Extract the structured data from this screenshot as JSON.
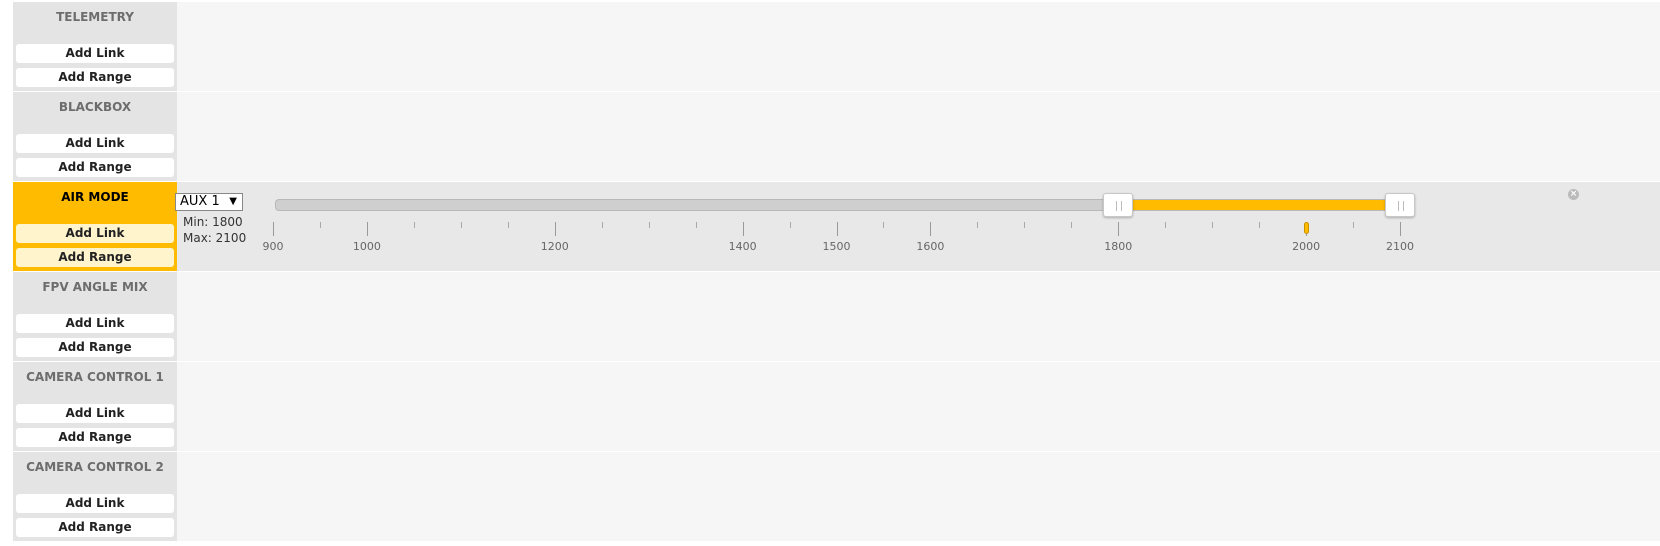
{
  "modes": [
    {
      "name": "TELEMETRY",
      "add_link": "Add Link",
      "add_range": "Add Range"
    },
    {
      "name": "BLACKBOX",
      "add_link": "Add Link",
      "add_range": "Add Range"
    },
    {
      "name": "AIR MODE",
      "add_link": "Add Link",
      "add_range": "Add Range",
      "active": true,
      "range": {
        "channel": "AUX 1",
        "min_label": "Min: 1800",
        "max_label": "Max: 2100",
        "min": 1800,
        "max": 2100,
        "current_value": 2000,
        "scale_min": 900,
        "scale_max": 2100,
        "tick_labels": [
          "900",
          "1000",
          "1200",
          "1400",
          "1500",
          "1600",
          "1800",
          "2000",
          "2100"
        ],
        "tick_values": [
          900,
          1000,
          1200,
          1400,
          1500,
          1600,
          1800,
          2000,
          2100
        ],
        "minor_ticks": [
          950,
          1050,
          1100,
          1150,
          1250,
          1300,
          1350,
          1450,
          1550,
          1650,
          1700,
          1750,
          1850,
          1900,
          1950,
          2050
        ],
        "fill_color": "#ffbb00"
      }
    },
    {
      "name": "FPV ANGLE MIX",
      "add_link": "Add Link",
      "add_range": "Add Range"
    },
    {
      "name": "CAMERA CONTROL 1",
      "add_link": "Add Link",
      "add_range": "Add Range"
    },
    {
      "name": "CAMERA CONTROL 2",
      "add_link": "Add Link",
      "add_range": "Add Range"
    }
  ],
  "colors": {
    "accent": "#ffbb00",
    "panel": "#e4e4e4",
    "row_bg": "#f6f6f6"
  },
  "icons": {
    "delete": "close-circle-icon",
    "dropdown": "chevron-down-icon",
    "handle": "grip-icon"
  }
}
